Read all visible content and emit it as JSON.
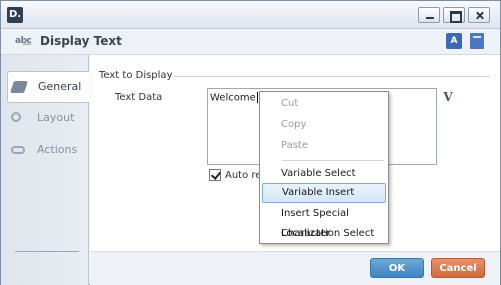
{
  "window": {
    "logo": "D.",
    "header_title": "Display Text",
    "translate_label": "A"
  },
  "sidebar": {
    "items": [
      {
        "label": "General",
        "icon": "pen-icon",
        "active": true
      },
      {
        "label": "Layout",
        "icon": "search-icon",
        "active": false
      },
      {
        "label": "Actions",
        "icon": "link-icon",
        "active": false
      }
    ]
  },
  "content": {
    "group_label": "Text to Display",
    "field_label": "Text Data",
    "text_value": "Welcome",
    "variable_button": "V",
    "checkbox_label": "Auto refresh",
    "checkbox_checked": true
  },
  "footer": {
    "ok_label": "OK",
    "cancel_label": "Cancel"
  },
  "context_menu": {
    "items": [
      {
        "label": "Cut",
        "enabled": false
      },
      {
        "label": "Copy",
        "enabled": false
      },
      {
        "label": "Paste",
        "enabled": false
      },
      {
        "label": "Variable Select",
        "enabled": true
      },
      {
        "label": "Variable Insert",
        "enabled": true,
        "highlighted": true
      },
      {
        "label": "Insert Special Character",
        "enabled": true
      },
      {
        "label": "Localization Select",
        "enabled": true
      }
    ]
  },
  "colors": {
    "ok_button": "#4a90c8",
    "cancel_button": "#d9764a",
    "menu_highlight": "#d4e6f8"
  }
}
